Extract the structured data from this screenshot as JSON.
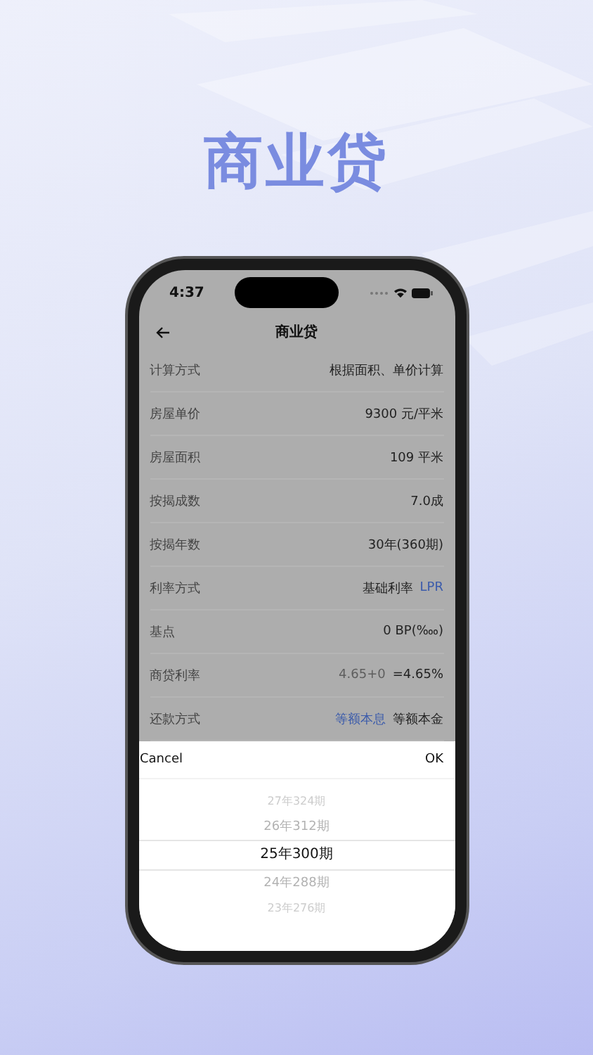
{
  "headline": "商业贷",
  "status_bar": {
    "time": "4:37"
  },
  "nav": {
    "title": "商业贷"
  },
  "rows": [
    {
      "label": "计算方式",
      "kind": "value",
      "parts": [
        {
          "text": "根据面积、单价计算",
          "muted": false
        }
      ]
    },
    {
      "label": "房屋单价",
      "kind": "value",
      "parts": [
        {
          "text": "9300 元/平米",
          "muted": false
        }
      ]
    },
    {
      "label": "房屋面积",
      "kind": "value",
      "parts": [
        {
          "text": "109 平米",
          "muted": false
        }
      ]
    },
    {
      "label": "按揭成数",
      "kind": "value",
      "parts": [
        {
          "text": "7.0成",
          "muted": false
        }
      ]
    },
    {
      "label": "按揭年数",
      "kind": "value",
      "parts": [
        {
          "text": "30年(360期)",
          "muted": false
        }
      ]
    },
    {
      "label": "利率方式",
      "kind": "options",
      "options": [
        {
          "text": "基础利率",
          "selected": false
        },
        {
          "text": "LPR",
          "selected": true
        }
      ]
    },
    {
      "label": "基点",
      "kind": "value",
      "parts": [
        {
          "text": "0 BP(‱)",
          "muted": false
        }
      ]
    },
    {
      "label": "商贷利率",
      "kind": "value",
      "parts": [
        {
          "text": "4.65+0",
          "muted": true
        },
        {
          "text": "=4.65%",
          "muted": false
        }
      ]
    },
    {
      "label": "还款方式",
      "kind": "options",
      "options": [
        {
          "text": "等额本息",
          "selected": true
        },
        {
          "text": "等额本金",
          "selected": false
        }
      ]
    }
  ],
  "picker": {
    "cancel": "Cancel",
    "ok": "OK",
    "items": [
      {
        "text": "27年324期",
        "selected": false
      },
      {
        "text": "26年312期",
        "selected": false
      },
      {
        "text": "25年300期",
        "selected": true
      },
      {
        "text": "24年288期",
        "selected": false
      },
      {
        "text": "23年276期",
        "selected": false
      }
    ]
  }
}
